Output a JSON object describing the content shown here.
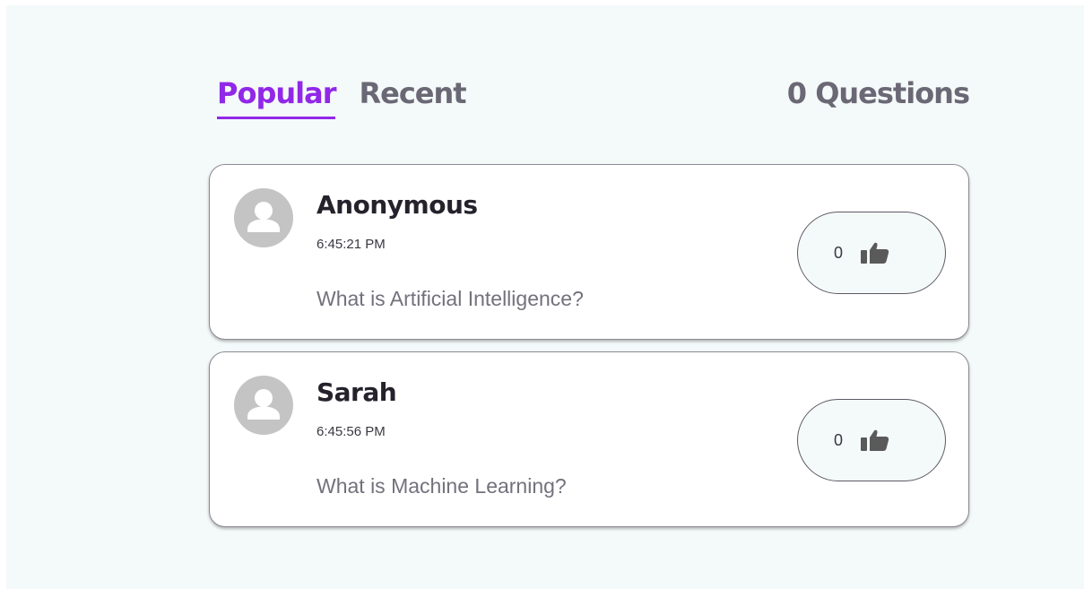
{
  "tabs": [
    {
      "label": "Popular",
      "active": true
    },
    {
      "label": "Recent",
      "active": false
    }
  ],
  "question_count": "0 Questions",
  "questions": [
    {
      "author": "Anonymous",
      "time": "6:45:21 PM",
      "text": "What is Artificial Intelligence?",
      "likes": "0"
    },
    {
      "author": "Sarah",
      "time": "6:45:56 PM",
      "text": "What is Machine Learning?",
      "likes": "0"
    }
  ],
  "icons": {
    "avatar": "user-avatar-icon",
    "like": "thumbs-up-icon"
  },
  "colors": {
    "accent": "#9128e8",
    "tab_inactive": "#6b6875",
    "background": "#f4f9f9"
  }
}
